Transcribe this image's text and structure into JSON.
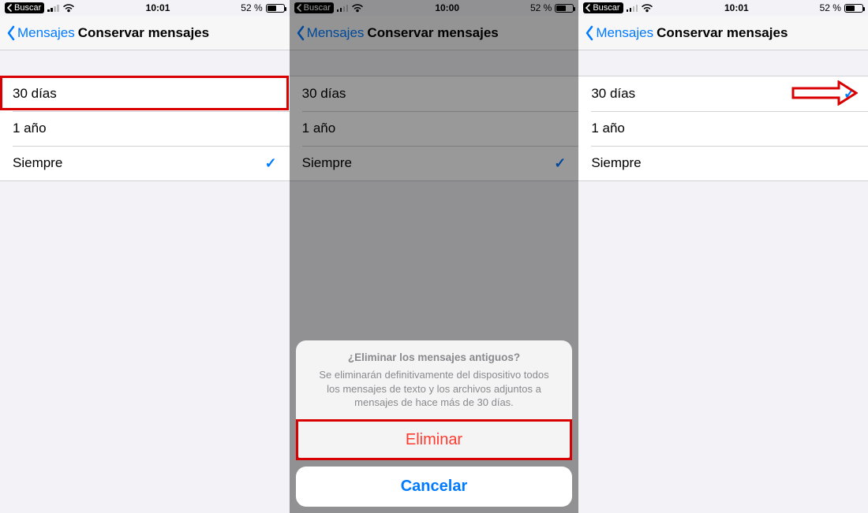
{
  "panels": [
    {
      "status": {
        "back_to": "Buscar",
        "time": "10:01",
        "battery_pct": "52 %",
        "battery_fill": 52
      },
      "nav": {
        "back_label": "Mensajes",
        "title": "Conservar mensajes"
      },
      "rows": [
        "30 días",
        "1 año",
        "Siempre"
      ],
      "checked_index": 2
    },
    {
      "status": {
        "back_to": "Buscar",
        "time": "10:00",
        "battery_pct": "52 %",
        "battery_fill": 52
      },
      "nav": {
        "back_label": "Mensajes",
        "title": "Conservar mensajes"
      },
      "rows": [
        "30 días",
        "1 año",
        "Siempre"
      ],
      "checked_index": 2,
      "sheet": {
        "title": "¿Eliminar los mensajes antiguos?",
        "message": "Se eliminarán definitivamente del dispositivo todos los mensajes de texto y los archivos adjuntos a mensajes de hace más de 30 días.",
        "destructive": "Eliminar",
        "cancel": "Cancelar"
      }
    },
    {
      "status": {
        "back_to": "Buscar",
        "time": "10:01",
        "battery_pct": "52 %",
        "battery_fill": 52
      },
      "nav": {
        "back_label": "Mensajes",
        "title": "Conservar mensajes"
      },
      "rows": [
        "30 días",
        "1 año",
        "Siempre"
      ],
      "checked_index": 0
    }
  ]
}
